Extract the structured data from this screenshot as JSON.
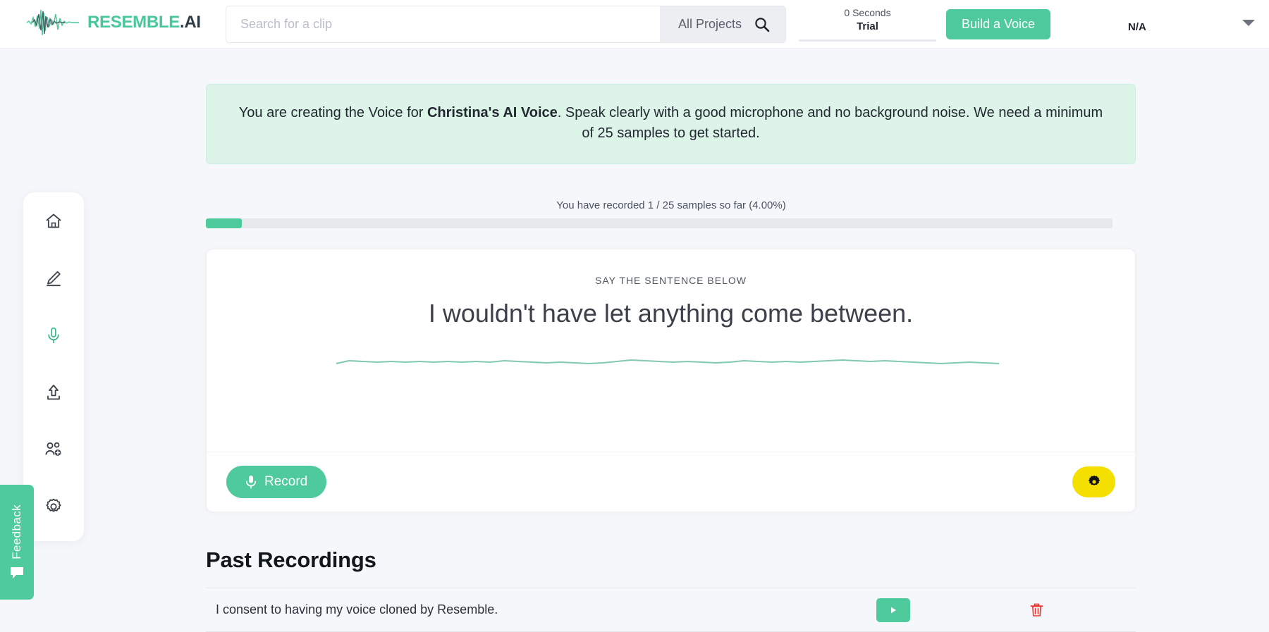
{
  "header": {
    "brand_primary": "RESEMBLE",
    "brand_dot": ".",
    "brand_secondary": "AI",
    "logo_icon": "waveform-icon",
    "search": {
      "placeholder": "Search for a clip",
      "value": "",
      "scope_label": "All Projects",
      "search_icon": "search-icon"
    },
    "usage": {
      "seconds": "0 Seconds",
      "plan": "Trial"
    },
    "build_voice_label": "Build a Voice",
    "account_label": "N/A",
    "caret_icon": "chevron-down-icon"
  },
  "sidebar": {
    "items": [
      {
        "name": "home",
        "icon": "home-icon",
        "active": false
      },
      {
        "name": "edit",
        "icon": "pencil-icon",
        "active": false
      },
      {
        "name": "record",
        "icon": "microphone-icon",
        "active": true
      },
      {
        "name": "upload",
        "icon": "upload-icon",
        "active": false
      },
      {
        "name": "team",
        "icon": "add-people-icon",
        "active": false
      },
      {
        "name": "settings",
        "icon": "gear-icon",
        "active": false
      }
    ]
  },
  "feedback": {
    "label": "Feedback",
    "icon": "speech-bubble-icon"
  },
  "banner": {
    "lead": "You are creating the Voice for ",
    "voice_name": "Christina's AI Voice",
    "tail": ". Speak clearly with a good microphone and no background noise. We need a minimum of 25 samples to get started."
  },
  "progress": {
    "label": "You have recorded 1 / 25 samples so far (4.00%)",
    "recorded": 1,
    "total": 25,
    "percent": "4.00%"
  },
  "record_card": {
    "say_label": "SAY THE SENTENCE BELOW",
    "sentence": "I wouldn't have let anything come between.",
    "waveform_icon": "audio-waveform",
    "record_button_label": "Record",
    "record_icon": "microphone-icon",
    "settings_icon": "gear-icon"
  },
  "past_recordings": {
    "title": "Past Recordings",
    "rows": [
      {
        "text": "I consent to having my voice cloned by Resemble.",
        "play_icon": "play-icon",
        "delete_icon": "trash-icon"
      }
    ]
  },
  "colors": {
    "accent_green": "#4fca9d",
    "banner_green": "#ddf5e9",
    "yellow": "#f4e000",
    "delete_red": "#f0342c",
    "page_bg": "#f5f7fb"
  }
}
